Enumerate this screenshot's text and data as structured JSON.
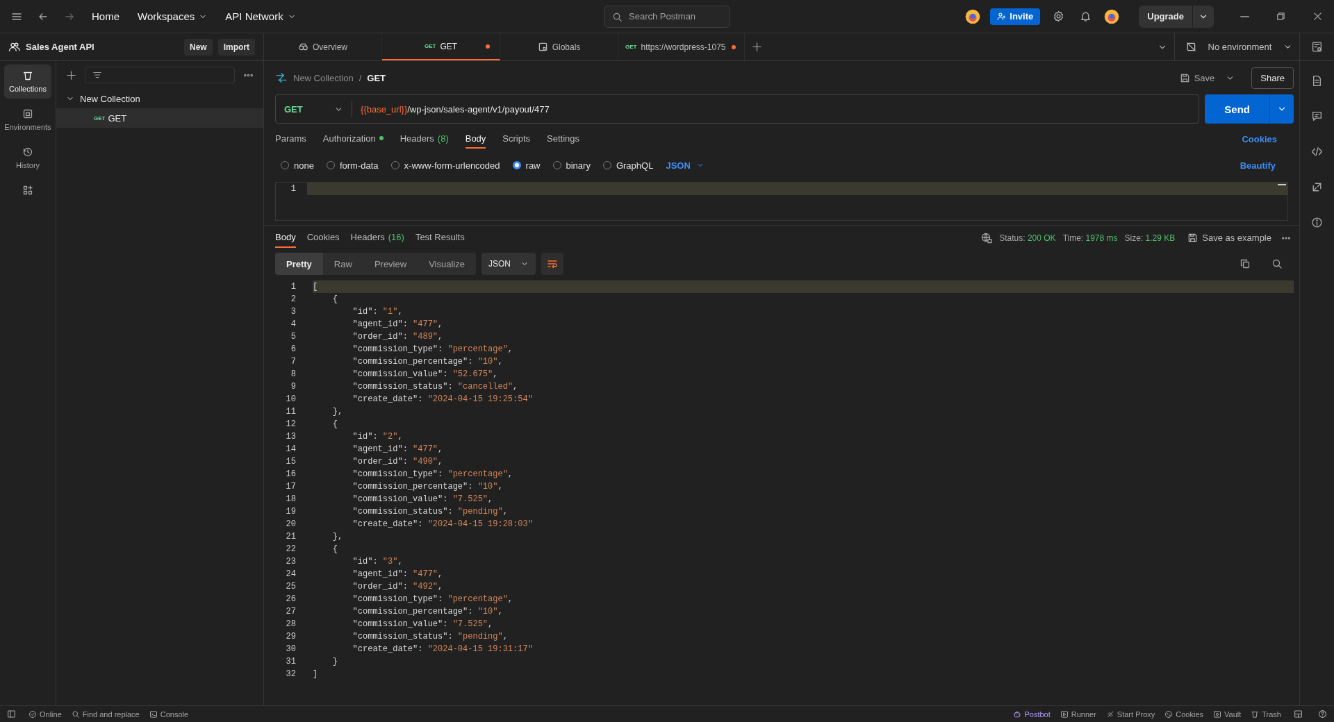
{
  "top_bar": {
    "nav": [
      {
        "label": "Home",
        "dropdown": false
      },
      {
        "label": "Workspaces",
        "dropdown": true
      },
      {
        "label": "API Network",
        "dropdown": true
      }
    ],
    "search": {
      "placeholder": "Search Postman"
    },
    "invite": "Invite",
    "upgrade": "Upgrade"
  },
  "workspace": {
    "name": "Sales Agent API",
    "buttons": [
      "New",
      "Import"
    ]
  },
  "rail": [
    {
      "kind": "collections",
      "label": "Collections",
      "selected": true
    },
    {
      "kind": "environments",
      "label": "Environments",
      "selected": false
    },
    {
      "kind": "history",
      "label": "History",
      "selected": false
    },
    {
      "kind": "apps",
      "selected": false
    }
  ],
  "tree": [
    {
      "name": "New Collection",
      "expanded": true,
      "children": [
        {
          "method": "GET",
          "name": "GET",
          "selected": true
        }
      ]
    }
  ],
  "tabs": [
    {
      "kind": "overview",
      "label": "Overview",
      "selected": false,
      "modified": false
    },
    {
      "kind": "request",
      "method": "GET",
      "label": "GET",
      "selected": true,
      "modified": true
    },
    {
      "kind": "globals",
      "label": "Globals",
      "selected": false,
      "modified": false
    },
    {
      "kind": "request",
      "method": "GET",
      "label": "https://wordpress-1075",
      "selected": false,
      "modified": true
    }
  ],
  "environment": "No environment",
  "breadcrumb": [
    "New Collection",
    "GET"
  ],
  "breadcrumb_separator": "/",
  "save": "Save",
  "share": "Share",
  "request": {
    "method": "GET",
    "url_variable": "{{base_url}}",
    "url_path": "/wp-json/sales-agent/v1/payout/477",
    "send": "Send"
  },
  "request_tabs": [
    {
      "label": "Params",
      "selected": false,
      "indicator": false
    },
    {
      "label": "Authorization",
      "selected": false,
      "indicator": true
    },
    {
      "label": "Headers",
      "count": "(8)",
      "selected": false,
      "indicator": false
    },
    {
      "label": "Body",
      "selected": true,
      "indicator": false
    },
    {
      "label": "Scripts",
      "selected": false,
      "indicator": false
    },
    {
      "label": "Settings",
      "selected": false,
      "indicator": false
    }
  ],
  "cookies_link": "Cookies",
  "body_types": [
    {
      "label": "none",
      "selected": false
    },
    {
      "label": "form-data",
      "selected": false
    },
    {
      "label": "x-www-form-urlencoded",
      "selected": false
    },
    {
      "label": "raw",
      "selected": true
    },
    {
      "label": "binary",
      "selected": false
    },
    {
      "label": "GraphQL",
      "selected": false
    }
  ],
  "body_language": "JSON",
  "beautify": "Beautify",
  "request_editor": {
    "line_numbers": [
      "1"
    ]
  },
  "response": {
    "tabs": [
      {
        "label": "Body",
        "selected": true
      },
      {
        "label": "Cookies",
        "selected": false
      },
      {
        "label": "Headers",
        "count": "(16)",
        "selected": false
      },
      {
        "label": "Test Results",
        "selected": false
      }
    ],
    "status_label": "Status:",
    "status": "200 OK",
    "time_label": "Time:",
    "time": "1978 ms",
    "size_label": "Size:",
    "size": "1.29 KB",
    "save_example": "Save as example",
    "views": [
      {
        "label": "Pretty",
        "selected": true
      },
      {
        "label": "Raw",
        "selected": false
      },
      {
        "label": "Preview",
        "selected": false
      },
      {
        "label": "Visualize",
        "selected": false
      }
    ],
    "format": "JSON",
    "lines": [
      {
        "n": "1",
        "text": "["
      },
      {
        "n": "2",
        "text": "    {"
      },
      {
        "n": "3",
        "text": "        \"id\": \"1\","
      },
      {
        "n": "4",
        "text": "        \"agent_id\": \"477\","
      },
      {
        "n": "5",
        "text": "        \"order_id\": \"489\","
      },
      {
        "n": "6",
        "text": "        \"commission_type\": \"percentage\","
      },
      {
        "n": "7",
        "text": "        \"commission_percentage\": \"10\","
      },
      {
        "n": "8",
        "text": "        \"commission_value\": \"52.675\","
      },
      {
        "n": "9",
        "text": "        \"commission_status\": \"cancelled\","
      },
      {
        "n": "10",
        "text": "        \"create_date\": \"2024-04-15 19:25:54\""
      },
      {
        "n": "11",
        "text": "    },"
      },
      {
        "n": "12",
        "text": "    {"
      },
      {
        "n": "13",
        "text": "        \"id\": \"2\","
      },
      {
        "n": "14",
        "text": "        \"agent_id\": \"477\","
      },
      {
        "n": "15",
        "text": "        \"order_id\": \"490\","
      },
      {
        "n": "16",
        "text": "        \"commission_type\": \"percentage\","
      },
      {
        "n": "17",
        "text": "        \"commission_percentage\": \"10\","
      },
      {
        "n": "18",
        "text": "        \"commission_value\": \"7.525\","
      },
      {
        "n": "19",
        "text": "        \"commission_status\": \"pending\","
      },
      {
        "n": "20",
        "text": "        \"create_date\": \"2024-04-15 19:28:03\""
      },
      {
        "n": "21",
        "text": "    },"
      },
      {
        "n": "22",
        "text": "    {"
      },
      {
        "n": "23",
        "text": "        \"id\": \"3\","
      },
      {
        "n": "24",
        "text": "        \"agent_id\": \"477\","
      },
      {
        "n": "25",
        "text": "        \"order_id\": \"492\","
      },
      {
        "n": "26",
        "text": "        \"commission_type\": \"percentage\","
      },
      {
        "n": "27",
        "text": "        \"commission_percentage\": \"10\","
      },
      {
        "n": "28",
        "text": "        \"commission_value\": \"7.525\","
      },
      {
        "n": "29",
        "text": "        \"commission_status\": \"pending\","
      },
      {
        "n": "30",
        "text": "        \"create_date\": \"2024-04-15 19:31:17\""
      },
      {
        "n": "31",
        "text": "    }"
      },
      {
        "n": "32",
        "text": "]"
      }
    ]
  },
  "status_bar": {
    "left": [
      {
        "kind": "online",
        "label": "Online",
        "accent": false
      },
      {
        "kind": "find",
        "label": "Find and replace",
        "accent": false
      },
      {
        "kind": "console",
        "label": "Console",
        "accent": false
      }
    ],
    "right": [
      {
        "kind": "postbot",
        "label": "Postbot",
        "accent": true
      },
      {
        "kind": "runner",
        "label": "Runner",
        "accent": false
      },
      {
        "kind": "proxy",
        "label": "Start Proxy",
        "accent": false
      },
      {
        "kind": "cookies",
        "label": "Cookies",
        "accent": false
      },
      {
        "kind": "vault",
        "label": "Vault",
        "accent": false
      },
      {
        "kind": "trash",
        "label": "Trash",
        "accent": false
      }
    ]
  }
}
